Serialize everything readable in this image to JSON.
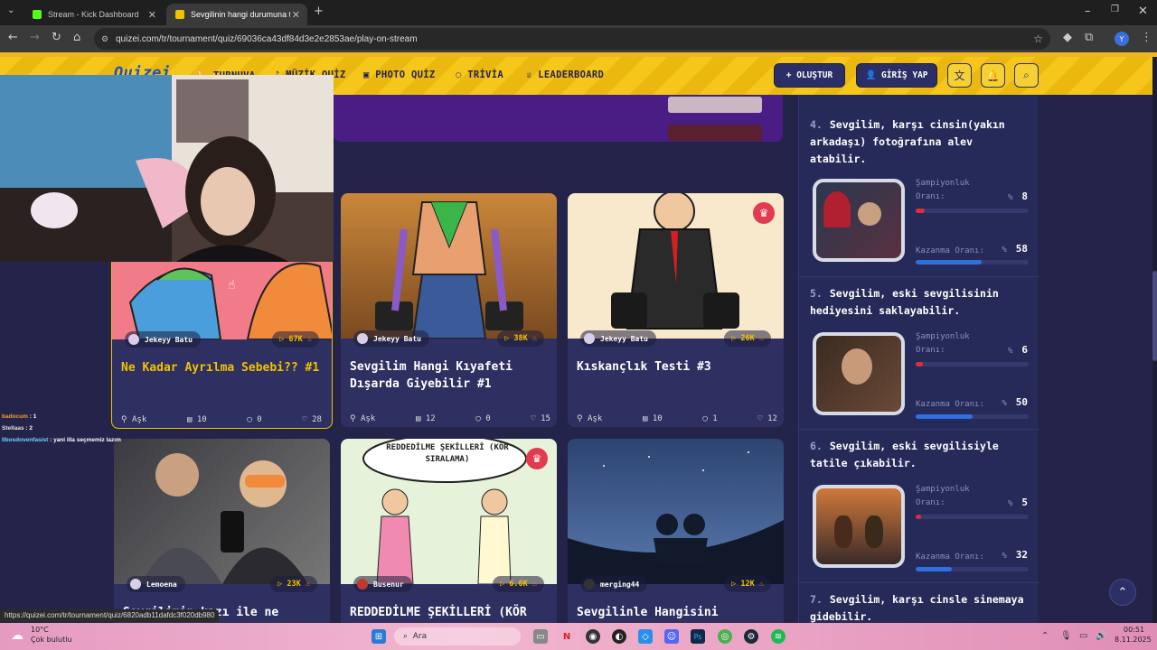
{
  "browser": {
    "tabs": [
      {
        "title": "Stream - Kick Dashboard",
        "active": false
      },
      {
        "title": "Sevgilinin hangi durumuna taha",
        "active": true
      }
    ],
    "url": "quizei.com/tr/tournament/quiz/69036ca43df84d3e2e2853ae/play-on-stream",
    "status_url": "https://quizei.com/tr/tournament/quiz/6820adb11dafdc3f020db980"
  },
  "site": {
    "logo": "Quizei",
    "nav": [
      {
        "label": "TURNUVA",
        "icon": "trophy-icon"
      },
      {
        "label": "MÜZİK QUİZ",
        "icon": "music-icon"
      },
      {
        "label": "PHOTO QUİZ",
        "icon": "camera-icon"
      },
      {
        "label": "TRİVİA",
        "icon": "chat-icon"
      },
      {
        "label": "LEADERBOARD",
        "icon": "award-icon"
      }
    ],
    "create_label": "+ OLUŞTUR",
    "login_label": "GİRİŞ YAP"
  },
  "cards": [
    {
      "author": "Jekeyy Batu",
      "plays": "67K",
      "title": "Ne Kadar Ayrılma Sebebi?? #1",
      "category": "Aşk",
      "items": "10",
      "comments": "0",
      "likes": "28",
      "selected": true,
      "premium": false
    },
    {
      "author": "Jekeyy Batu",
      "plays": "38K",
      "title": "Sevgilim Hangi Kıyafeti Dışarda Giyebilir #1",
      "category": "Aşk",
      "items": "12",
      "comments": "0",
      "likes": "15",
      "selected": false,
      "premium": false
    },
    {
      "author": "Jekeyy Batu",
      "plays": "26K",
      "title": "Kıskançlık Testi #3",
      "category": "Aşk",
      "items": "10",
      "comments": "1",
      "likes": "12",
      "selected": false,
      "premium": true
    },
    {
      "author": "Lemoena",
      "plays": "23K",
      "title": "Sevgilimin kızı ile ne",
      "category": "",
      "items": "",
      "comments": "",
      "likes": "",
      "selected": false,
      "premium": false
    },
    {
      "author": "Busenur",
      "plays": "6.6K",
      "title": "REDDEDİLME ŞEKİLLERİ (KÖR",
      "category": "",
      "items": "",
      "comments": "",
      "likes": "",
      "selected": false,
      "premium": true,
      "thumb_text": "REDDEDİLME ŞEKİLLERİ (KÖR SIRALAMA)"
    },
    {
      "author": "merging44",
      "plays": "12K",
      "title": "Sevgilinle Hangisini",
      "category": "",
      "items": "",
      "comments": "",
      "likes": "",
      "selected": false,
      "premium": false
    }
  ],
  "ranking": [
    {
      "num": "4.",
      "text": "Sevgilim, karşı cinsin(yakın arkadaşı) fotoğrafına alev atabilir.",
      "champ_label": "Şampiyonluk Oranı:",
      "champ": "8",
      "win_label": "Kazanma Oranı:",
      "win": "58",
      "champ_pct": 8,
      "win_pct": 58
    },
    {
      "num": "5.",
      "text": "Sevgilim, eski sevgilisinin hediyesini saklayabilir.",
      "champ_label": "Şampiyonluk Oranı:",
      "champ": "6",
      "win_label": "Kazanma Oranı:",
      "win": "50",
      "champ_pct": 6,
      "win_pct": 50
    },
    {
      "num": "6.",
      "text": "Sevgilim, eski sevgilisiyle tatile çıkabilir.",
      "champ_label": "Şampiyonluk Oranı:",
      "champ": "5",
      "win_label": "Kazanma Oranı:",
      "win": "32",
      "champ_pct": 5,
      "win_pct": 32
    },
    {
      "num": "7.",
      "text": "Sevgilim, karşı cinsle sinemaya gidebilir.",
      "champ_label": "",
      "champ": "",
      "win_label": "",
      "win": "",
      "champ_pct": 0,
      "win_pct": 0
    }
  ],
  "percent_sign": "%",
  "chat": [
    {
      "user": "badocum",
      "msg": ": 1",
      "color": "#f0a030"
    },
    {
      "user": "Stellaas",
      "msg": ": 2",
      "color": "#e0e0e0"
    },
    {
      "user": "Ilbosdovenfasist",
      "msg": ": yani illa seçmemiz lazım",
      "color": "#6fd4ff"
    }
  ],
  "taskbar": {
    "weather_temp": "10°C",
    "weather_desc": "Çok bulutlu",
    "search_label": "Ara",
    "time": "00:51",
    "date": "8.11.2025"
  },
  "colors": {
    "accent": "#f2c200",
    "navy": "#2b2f66",
    "champ_bar": "#e02d3c",
    "win_bar": "#2f6fe0"
  }
}
